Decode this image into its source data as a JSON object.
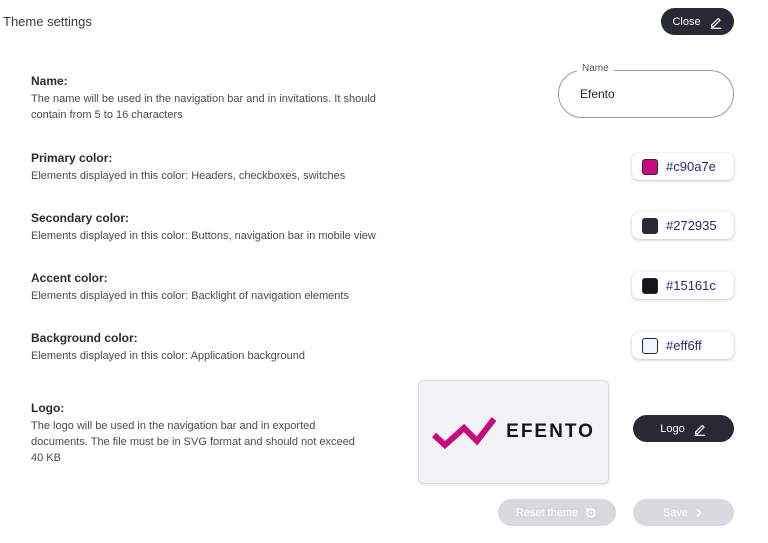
{
  "header": {
    "title": "Theme settings",
    "close_label": "Close",
    "close_icon": "pencil-icon"
  },
  "name_section": {
    "label": "Name:",
    "description": "The name will be used in the navigation bar and in invitations. It should contain from 5 to 16 characters",
    "field_legend": "Name",
    "field_value": "Efento"
  },
  "colors": [
    {
      "label": "Primary color:",
      "description": "Elements displayed in this color: Headers, checkboxes, switches",
      "hex": "#c90a7e",
      "swatch": "#c90a7e"
    },
    {
      "label": "Secondary color:",
      "description": "Elements displayed in this color: Buttons, navigation bar in mobile view",
      "hex": "#272935",
      "swatch": "#272935"
    },
    {
      "label": "Accent color:",
      "description": "Elements displayed in this color: Backlight of navigation elements",
      "hex": "#15161c",
      "swatch": "#15161c"
    },
    {
      "label": "Background color:",
      "description": "Elements displayed in this color: Application background",
      "hex": "#eff6ff",
      "swatch": "#eff6ff"
    }
  ],
  "logo_section": {
    "label": "Logo:",
    "description": "The logo will be used in the navigation bar and in exported documents. The file must be in SVG format and should not exceed 40 KB",
    "brand_text": "EFENTO",
    "brand_color": "#c90a7e",
    "button_label": "Logo",
    "button_icon": "pencil-icon"
  },
  "footer": {
    "reset_label": "Reset theme",
    "reset_icon": "reset-icon",
    "save_label": "Save",
    "save_icon": "chevron-right-icon"
  }
}
